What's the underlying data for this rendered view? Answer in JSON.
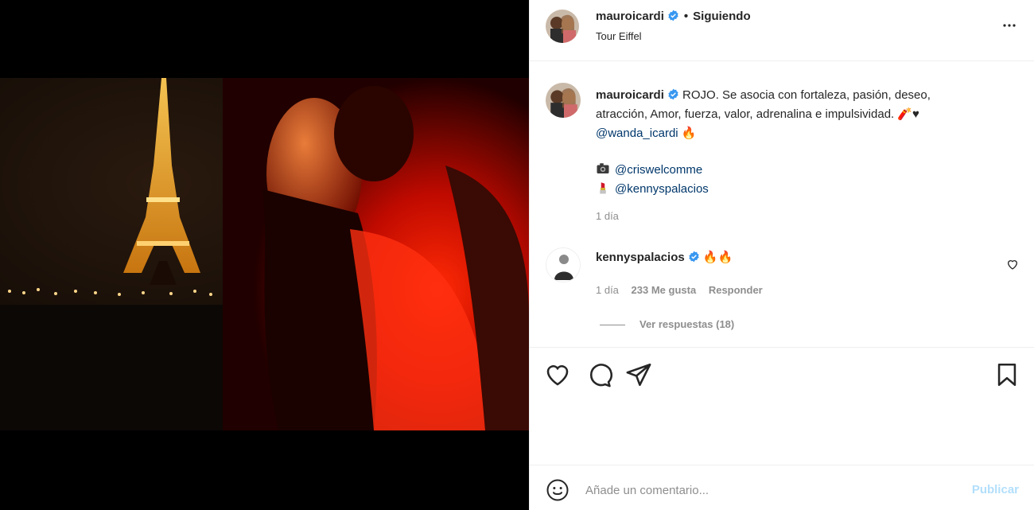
{
  "post": {
    "author": {
      "username": "mauroicardi",
      "verified": true,
      "follow_status": "Siguiendo",
      "location": "Tour Eiffel"
    },
    "media": {
      "scene_text": "",
      "accent_color": "#ff1a00"
    },
    "caption": {
      "username": "mauroicardi",
      "line1": "ROJO. Se asocia con fortaleza, pasión, deseo,",
      "line2": "atracción, Amor, fuerza, valor, adrenalina e impulsividad. 🧨♥",
      "mention": "@wanda_icardi",
      "mention_emoji": "🔥",
      "credit_photo_icon": "camera-icon",
      "credit_photo": "@criswelcomme",
      "credit_makeup_icon": "lipstick-icon",
      "credit_makeup": "@kennyspalacios",
      "time": "1 día"
    },
    "comments": [
      {
        "username": "kennyspalacios",
        "verified": true,
        "text": "🔥🔥",
        "time": "1 día",
        "likes": "233 Me gusta",
        "reply_label": "Responder",
        "view_replies": "Ver respuestas (18)"
      }
    ],
    "actions": {
      "like_icon": "heart-icon",
      "comment_icon": "comment-icon",
      "share_icon": "share-icon",
      "save_icon": "bookmark-icon"
    },
    "add_comment": {
      "placeholder": "Añade un comentario...",
      "publish_label": "Publicar",
      "publish_color": "#b2dffc"
    },
    "colors": {
      "link": "#00376b",
      "verified": "#3897f0",
      "muted": "#8e8e8e"
    }
  }
}
